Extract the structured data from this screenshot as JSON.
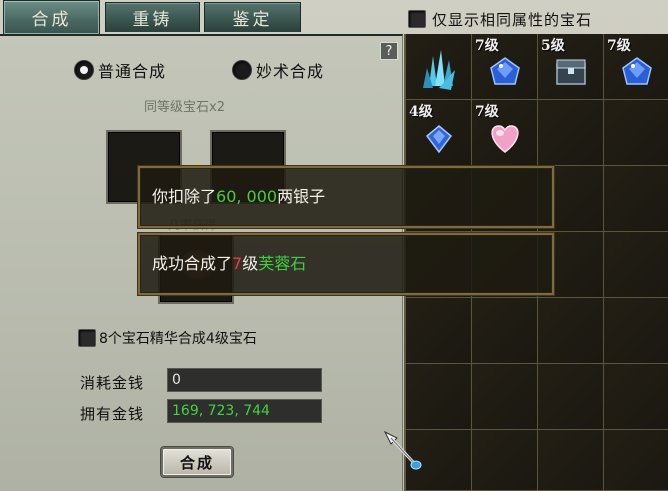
{
  "tabs": [
    {
      "label": "合成",
      "active": true
    },
    {
      "label": "重铸",
      "active": false
    },
    {
      "label": "鉴定",
      "active": false
    }
  ],
  "filter": {
    "label": "仅显示相同属性的宝石",
    "checked": false
  },
  "left": {
    "help_label": "?",
    "mode_normal": "普通合成",
    "mode_magic": "妙术合成",
    "selected_mode": "普通合成",
    "requirement": "同等级宝石x2",
    "plus": "+",
    "under_text": "几率获得",
    "essence_label": "8个宝石精华合成4级宝石",
    "cost_label": "消耗金钱",
    "cost_value": "0",
    "owned_label": "拥有金钱",
    "owned_value": "169, 723, 744",
    "compose_button": "合成"
  },
  "inventory": [
    {
      "level": "",
      "gem": "blue-crystal-cluster"
    },
    {
      "level": "7级",
      "gem": "blue-sapphire"
    },
    {
      "level": "5级",
      "gem": "dark-chest"
    },
    {
      "level": "7级",
      "gem": "blue-sapphire"
    },
    {
      "level": "4级",
      "gem": "blue-diamond"
    },
    {
      "level": "7级",
      "gem": "pink-heart"
    }
  ],
  "popups": {
    "deduct_prefix": "你扣除了",
    "deduct_amount": "60, 000",
    "deduct_suffix": "两银子",
    "success_prefix": "成功合成了",
    "success_level": "7",
    "success_unit": "级",
    "success_gem": "芙蓉石"
  },
  "colors": {
    "money_green": "#40d440",
    "level_red": "#e53b3b",
    "tab_active": "#4b6a63"
  }
}
